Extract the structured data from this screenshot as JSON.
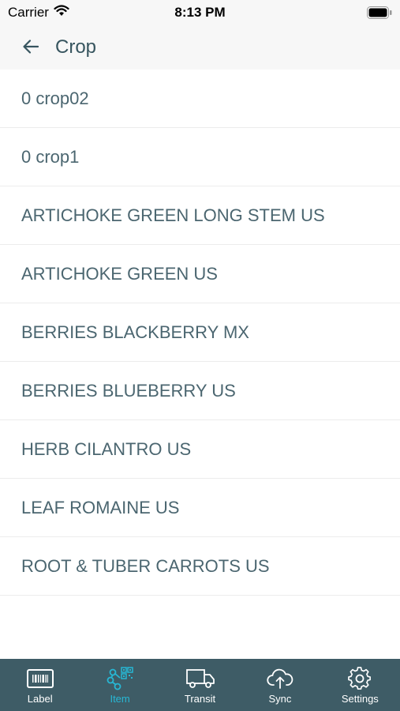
{
  "status_bar": {
    "carrier": "Carrier",
    "time": "8:13 PM"
  },
  "header": {
    "title": "Crop",
    "back_icon": "arrow-left-icon"
  },
  "crops": [
    "0 crop02",
    "0 crop1",
    "ARTICHOKE GREEN LONG STEM US",
    "ARTICHOKE GREEN US",
    "BERRIES BLACKBERRY MX",
    "BERRIES BLUEBERRY US",
    "HERB CILANTRO US",
    "LEAF ROMAINE US",
    "ROOT & TUBER CARROTS US"
  ],
  "tabs": [
    {
      "label": "Label",
      "icon": "barcode-icon",
      "active": false
    },
    {
      "label": "Item",
      "icon": "item-network-icon",
      "active": true
    },
    {
      "label": "Transit",
      "icon": "truck-icon",
      "active": false
    },
    {
      "label": "Sync",
      "icon": "cloud-upload-icon",
      "active": false
    },
    {
      "label": "Settings",
      "icon": "gear-icon",
      "active": false
    }
  ],
  "colors": {
    "tab_bar_bg": "#3e5c66",
    "tab_active": "#27b7d4",
    "text": "#4b6670"
  }
}
